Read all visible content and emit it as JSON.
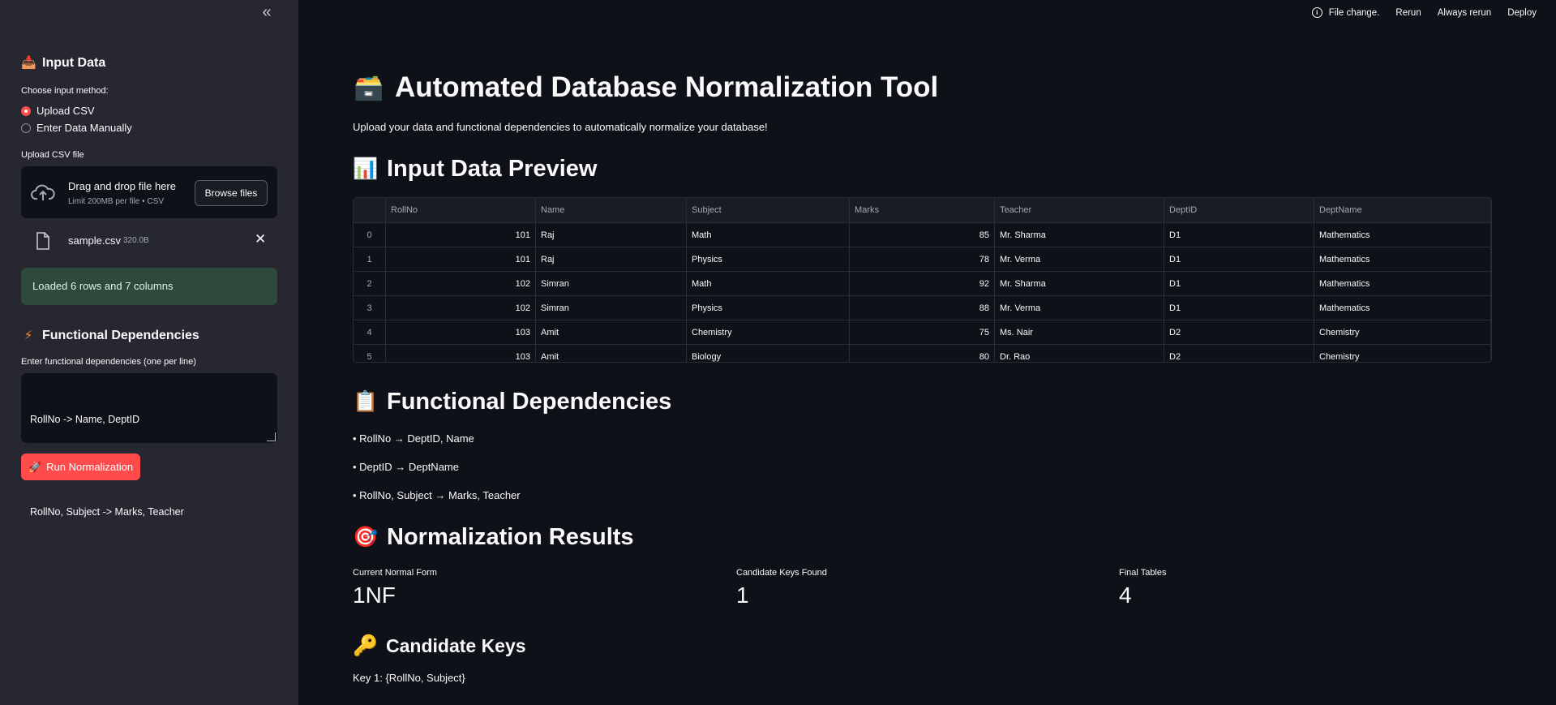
{
  "sidebar": {
    "collapse_label": "«",
    "input_section": {
      "heading": "Input Data",
      "method_label": "Choose input method:",
      "options": [
        "Upload CSV",
        "Enter Data Manually"
      ],
      "selected_option": "Upload CSV"
    },
    "upload": {
      "label": "Upload CSV file",
      "drop_title": "Drag and drop file here",
      "drop_subtitle": "Limit 200MB per file • CSV",
      "browse_label": "Browse files",
      "file_name": "sample.csv",
      "file_size": "320.0B",
      "remove_label": "✕"
    },
    "success_message": "Loaded 6 rows and 7 columns",
    "fd_section": {
      "heading": "Functional Dependencies",
      "label": "Enter functional dependencies (one per line)",
      "lines": [
        "RollNo -> Name, DeptID",
        "DeptID -> DeptName",
        "RollNo, Subject -> Marks, Teacher"
      ]
    },
    "run_button": "Run Normalization"
  },
  "topbar": {
    "status": "File change.",
    "rerun": "Rerun",
    "always_rerun": "Always rerun",
    "deploy": "Deploy"
  },
  "main": {
    "title": "Automated Database Normalization Tool",
    "subtitle": "Upload your data and functional dependencies to automatically normalize your database!",
    "preview_heading": "Input Data Preview",
    "table": {
      "columns": [
        "",
        "RollNo",
        "Name",
        "Subject",
        "Marks",
        "Teacher",
        "DeptID",
        "DeptName"
      ],
      "rows": [
        [
          "0",
          "101",
          "Raj",
          "Math",
          "85",
          "Mr. Sharma",
          "D1",
          "Mathematics"
        ],
        [
          "1",
          "101",
          "Raj",
          "Physics",
          "78",
          "Mr. Verma",
          "D1",
          "Mathematics"
        ],
        [
          "2",
          "102",
          "Simran",
          "Math",
          "92",
          "Mr. Sharma",
          "D1",
          "Mathematics"
        ],
        [
          "3",
          "102",
          "Simran",
          "Physics",
          "88",
          "Mr. Verma",
          "D1",
          "Mathematics"
        ],
        [
          "4",
          "103",
          "Amit",
          "Chemistry",
          "75",
          "Ms. Nair",
          "D2",
          "Chemistry"
        ],
        [
          "5",
          "103",
          "Amit",
          "Biology",
          "80",
          "Dr. Rao",
          "D2",
          "Chemistry"
        ]
      ]
    },
    "fd_heading": "Functional Dependencies",
    "fd_items": [
      "• RollNo → DeptID, Name",
      "• DeptID → DeptName",
      "• RollNo, Subject → Marks, Teacher"
    ],
    "results_heading": "Normalization Results",
    "metrics": [
      {
        "label": "Current Normal Form",
        "value": "1NF"
      },
      {
        "label": "Candidate Keys Found",
        "value": "1"
      },
      {
        "label": "Final Tables",
        "value": "4"
      }
    ],
    "keys_heading": "Candidate Keys",
    "keys": [
      "Key 1: {RollNo, Subject}"
    ]
  },
  "colors": {
    "app_bg": "#0e1117",
    "sidebar_bg": "#262730",
    "accent": "#ff4b4b",
    "success_bg": "#2d4a3c"
  },
  "icons": {
    "title": "card-file-box-icon",
    "preview": "bar-chart-icon",
    "fd": "clipboard-icon",
    "results": "target-icon",
    "keys": "key-icon",
    "input": "inbox-tray-icon",
    "fd_sidebar": "lightning-icon",
    "run": "rocket-icon"
  }
}
